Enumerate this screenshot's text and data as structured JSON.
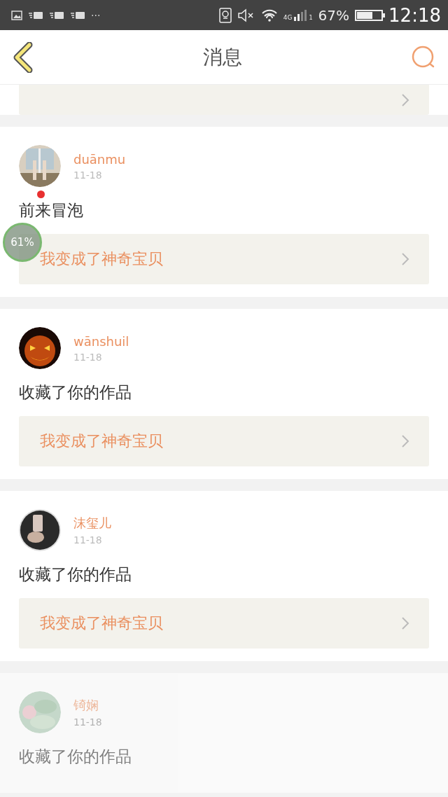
{
  "status_bar": {
    "more": "···",
    "network": "4G",
    "sim": "1",
    "battery_text": "67%",
    "time": "12:18"
  },
  "header": {
    "title": "消息"
  },
  "floating_ball": {
    "text": "61%"
  },
  "messages": [
    {
      "name": "duānmu",
      "date": "11-18",
      "text": "前来冒泡",
      "unread": true,
      "link": "我变成了神奇宝贝",
      "faded": false
    },
    {
      "name": "wānshuil",
      "date": "11-18",
      "text": "收藏了你的作品",
      "unread": false,
      "link": "我变成了神奇宝贝",
      "faded": false
    },
    {
      "name": "沫玺儿",
      "date": "11-18",
      "text": "收藏了你的作品",
      "unread": false,
      "link": "我变成了神奇宝贝",
      "faded": false
    },
    {
      "name": "锜娴",
      "date": "11-18",
      "text": "收藏了你的作品",
      "unread": false,
      "faded": true
    }
  ]
}
